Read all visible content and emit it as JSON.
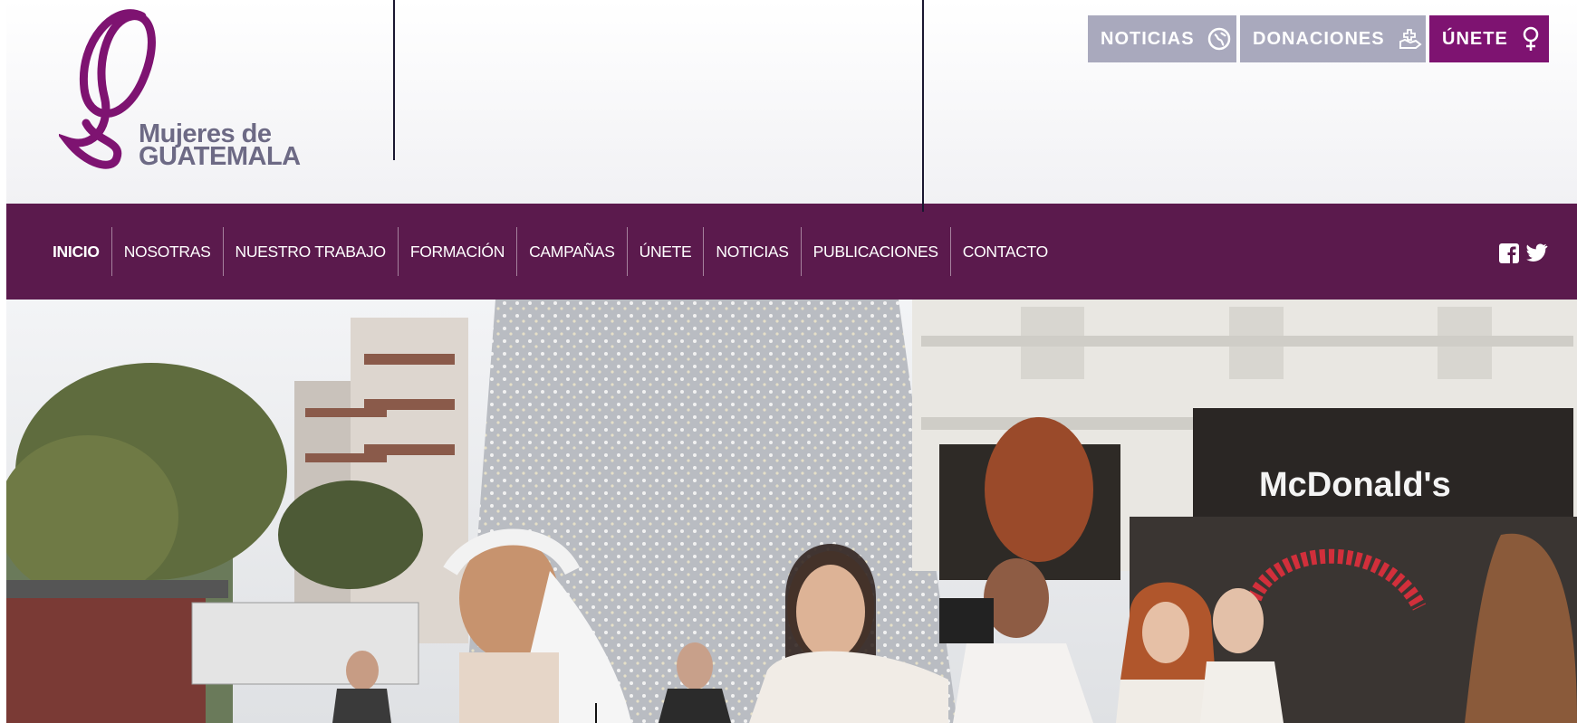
{
  "brand": {
    "line1": "Mujeres de",
    "line2": "GUATEMALA",
    "primary_color": "#7e1371",
    "nav_color": "#5b1a4d",
    "secondary_color": "#a9a9bd"
  },
  "top_buttons": [
    {
      "label": "NOTICIAS",
      "icon": "globe-icon"
    },
    {
      "label": "DONACIONES",
      "icon": "donate-hand-icon"
    },
    {
      "label": "ÚNETE",
      "icon": "female-symbol-icon"
    }
  ],
  "nav": {
    "items": [
      {
        "label": "INICIO"
      },
      {
        "label": "NOSOTRAS"
      },
      {
        "label": "NUESTRO TRABAJO"
      },
      {
        "label": "FORMACIÓN"
      },
      {
        "label": "CAMPAÑAS"
      },
      {
        "label": "ÚNETE"
      },
      {
        "label": "NOTICIAS"
      },
      {
        "label": "PUBLICACIONES"
      },
      {
        "label": "CONTACTO"
      }
    ],
    "social": [
      "facebook-icon",
      "twitter-icon"
    ]
  },
  "hero": {
    "storefront_sign": "McDonald's"
  }
}
